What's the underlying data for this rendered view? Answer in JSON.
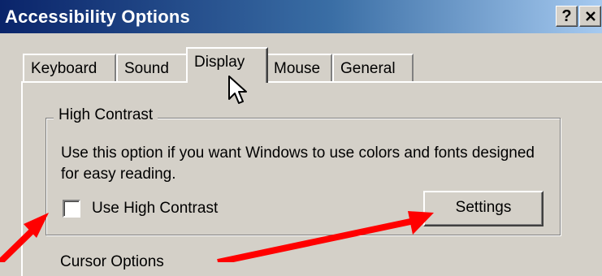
{
  "window": {
    "title": "Accessibility Options",
    "help_button": "?",
    "close_button": "✕"
  },
  "tabs": [
    {
      "label": "Keyboard",
      "active": false
    },
    {
      "label": "Sound",
      "active": false
    },
    {
      "label": "Display",
      "active": true
    },
    {
      "label": "Mouse",
      "active": false
    },
    {
      "label": "General",
      "active": false
    }
  ],
  "high_contrast": {
    "group_title": "High Contrast",
    "description": "Use this option if you want Windows to use colors and fonts designed for easy reading.",
    "checkbox_label": "Use High Contrast",
    "checkbox_checked": false,
    "settings_button": "Settings"
  },
  "next_group": {
    "partial_title": "Cursor Options"
  },
  "annotation": {
    "arrow_color": "#ff0000"
  },
  "colors": {
    "titlebar_start": "#0a246a",
    "titlebar_end": "#a6caf0",
    "face": "#d4d0c8"
  }
}
